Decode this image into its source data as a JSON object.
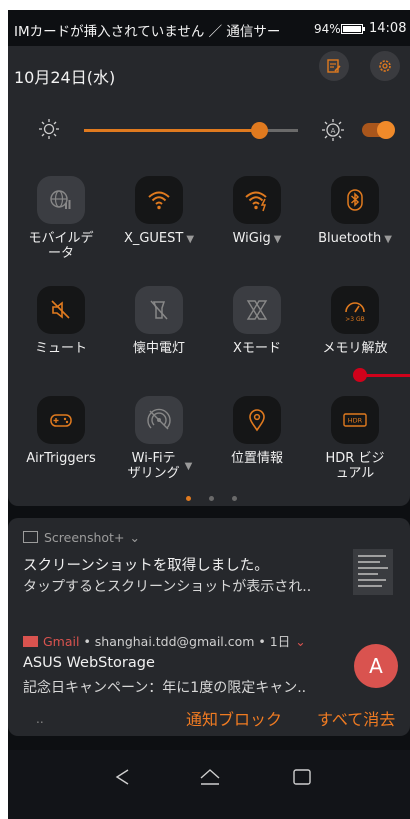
{
  "status_bar": {
    "carrier_text": "IMカードが挿入されていません ／ 通信サー",
    "battery": "94%",
    "time": "14:08"
  },
  "quick_settings": {
    "date": "10月24日(水)",
    "brightness": {
      "level": 0.82,
      "auto": true
    },
    "tiles": [
      {
        "label": "モバイルデータ",
        "icon": "globe-icon",
        "on": false,
        "dropdown": false
      },
      {
        "label": "X_GUEST",
        "icon": "wifi-icon",
        "on": true,
        "dropdown": true
      },
      {
        "label": "WiGig",
        "icon": "wigig-icon",
        "on": true,
        "dropdown": true
      },
      {
        "label": "Bluetooth",
        "icon": "bluetooth-icon",
        "on": true,
        "dropdown": true
      },
      {
        "label": "ミュート",
        "icon": "mute-icon",
        "on": true,
        "dropdown": false
      },
      {
        "label": "懐中電灯",
        "icon": "flashlight-icon",
        "on": false,
        "dropdown": false
      },
      {
        "label": "Xモード",
        "icon": "xmode-icon",
        "on": false,
        "dropdown": false
      },
      {
        "label": "メモリ解放",
        "icon": "memory-gauge-icon",
        "on": true,
        "dropdown": false,
        "badge": ">3 GB"
      },
      {
        "label": "AirTriggers",
        "icon": "gamepad-icon",
        "on": true,
        "dropdown": false
      },
      {
        "label": "Wi-Fiテザリング",
        "icon": "hotspot-icon",
        "on": false,
        "dropdown": true
      },
      {
        "label": "位置情報",
        "icon": "location-icon",
        "on": true,
        "dropdown": false
      },
      {
        "label": "HDR ビジュアル",
        "icon": "hdr-icon",
        "on": true,
        "dropdown": false,
        "badge": "HDR"
      }
    ],
    "page_dots": {
      "count": 3,
      "active": 0
    }
  },
  "notifications": {
    "screenshot": {
      "app": "Screenshot+",
      "title": "スクリーンショットを取得しました。",
      "text": "タップするとスクリーンショットが表示され.."
    },
    "gmail": {
      "app": "Gmail",
      "account": "shanghai.tdd@gmail.com",
      "time": "1日",
      "title": "ASUS WebStorage",
      "text": "記念日キャンペーン：年に1度の限定キャン..",
      "avatar_letter": "A"
    },
    "footer_dots": "..",
    "block_label": "通知ブロック",
    "clear_all_label": "すべて消去"
  },
  "colors": {
    "accent": "#e07a1f",
    "tile_bg": "#3b3d42",
    "panel_bg": "#26282c",
    "gmail_red": "#d9534f",
    "cursor": "#d0021b"
  }
}
